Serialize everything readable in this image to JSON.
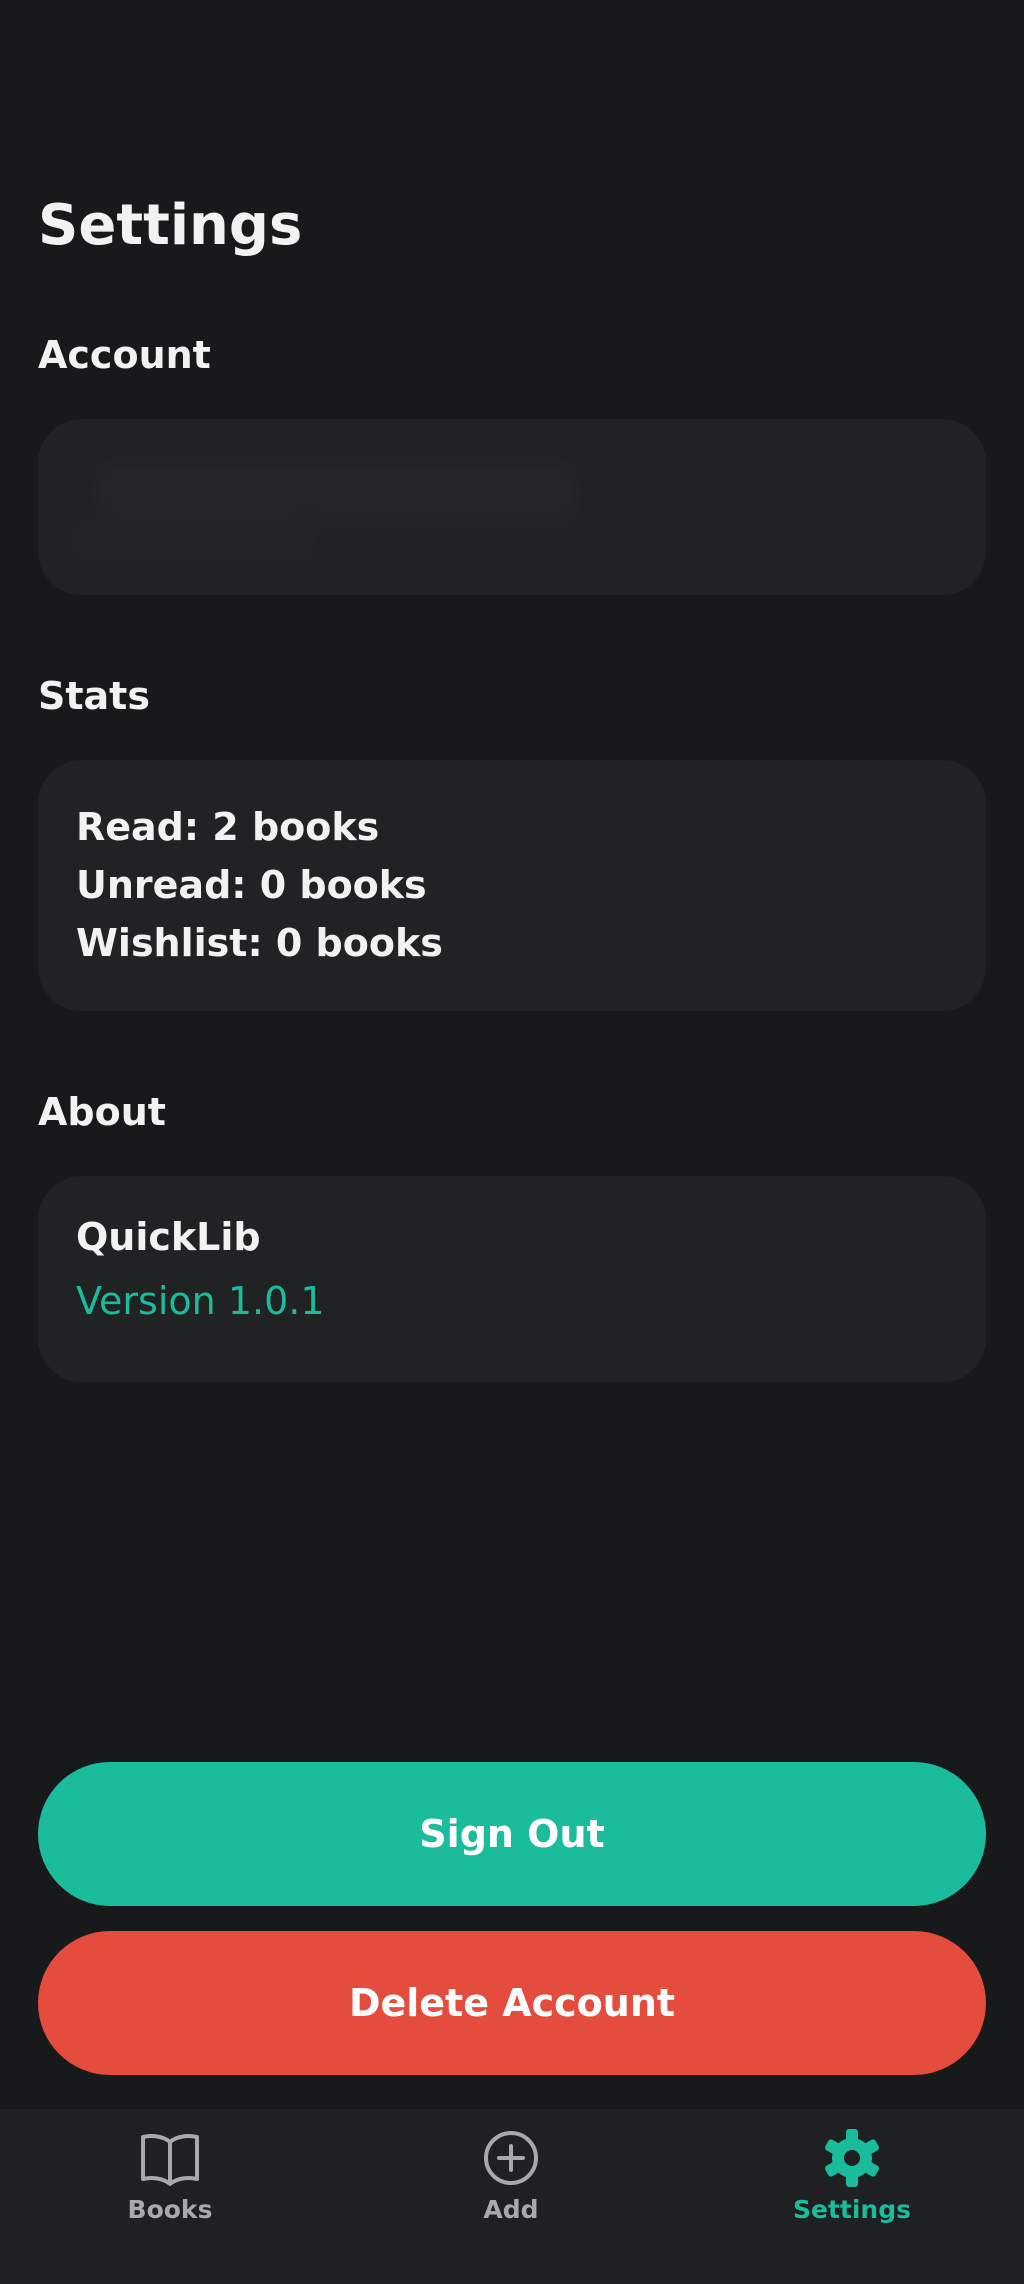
{
  "header": {
    "title": "Settings"
  },
  "account": {
    "section_title": "Account"
  },
  "stats": {
    "section_title": "Stats",
    "lines": [
      "Read: 2 books",
      "Unread: 0 books",
      "Wishlist: 0 books"
    ]
  },
  "about": {
    "section_title": "About",
    "app_name": "QuickLib",
    "version": "Version 1.0.1"
  },
  "actions": {
    "sign_out_label": "Sign Out",
    "delete_account_label": "Delete Account"
  },
  "nav": {
    "items": [
      {
        "label": "Books",
        "icon": "book-open-icon",
        "active": false
      },
      {
        "label": "Add",
        "icon": "add-circle-icon",
        "active": false
      },
      {
        "label": "Settings",
        "icon": "gear-icon",
        "active": true
      }
    ]
  },
  "colors": {
    "background": "#18191b",
    "card": "#212224",
    "accent": "#1abc9c",
    "danger": "#e44d3d",
    "nav_inactive": "#a9a9ab"
  }
}
